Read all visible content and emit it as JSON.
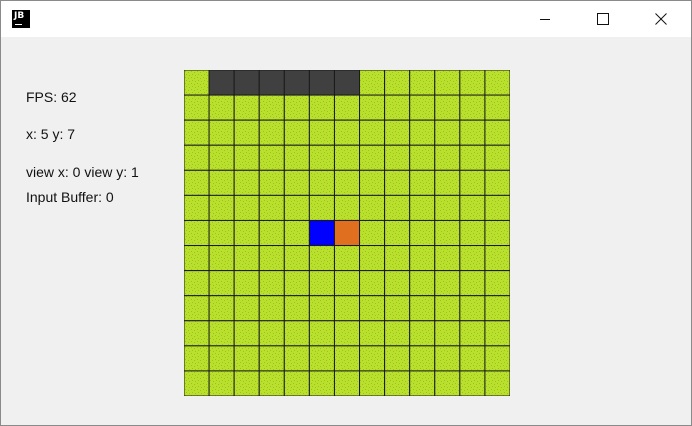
{
  "window": {
    "icon_text": "JB"
  },
  "hud": {
    "fps": "FPS: 62",
    "position": "x: 5 y: 7",
    "view": "view x: 0 view y: 1",
    "input_buffer": "Input Buffer: 0"
  },
  "board": {
    "columns": 13,
    "rows": 13,
    "colors": {
      "grass": "#b9e02c",
      "grass_speckle": "#9cc221",
      "wall": "#404040",
      "player": "#0000ff",
      "target": "#e07020",
      "grid_line": "#1a1a1a"
    },
    "wall_cells": [
      {
        "col": 1,
        "row": 0
      },
      {
        "col": 2,
        "row": 0
      },
      {
        "col": 3,
        "row": 0
      },
      {
        "col": 4,
        "row": 0
      },
      {
        "col": 5,
        "row": 0
      },
      {
        "col": 6,
        "row": 0
      }
    ],
    "player_cell": {
      "col": 5,
      "row": 6
    },
    "target_cell": {
      "col": 6,
      "row": 6
    }
  }
}
